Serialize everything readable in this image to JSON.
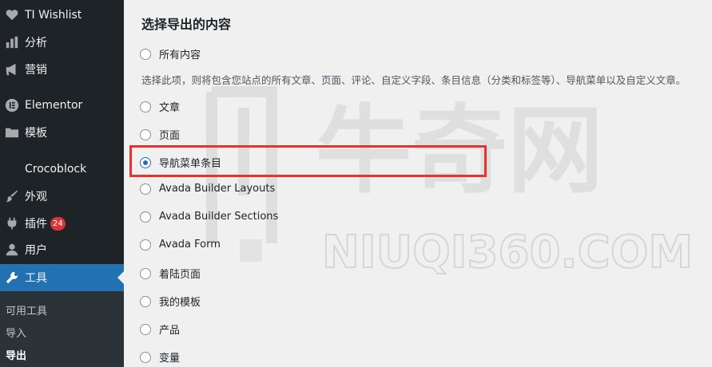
{
  "sidebar": {
    "items": [
      {
        "label": "TI Wishlist",
        "icon": "heart-icon"
      },
      {
        "label": "分析",
        "icon": "chart-icon"
      },
      {
        "label": "营销",
        "icon": "megaphone-icon"
      },
      {
        "label": "Elementor",
        "icon": "elementor-icon"
      },
      {
        "label": "模板",
        "icon": "folder-icon"
      },
      {
        "label": "Crocoblock",
        "icon": ""
      },
      {
        "label": "外观",
        "icon": "paintbrush-icon"
      },
      {
        "label": "插件",
        "icon": "plugin-icon",
        "badge": "24"
      },
      {
        "label": "用户",
        "icon": "user-icon"
      },
      {
        "label": "工具",
        "icon": "wrench-icon",
        "active": true
      }
    ],
    "submenu": [
      "可用工具",
      "导入",
      "导出"
    ],
    "current_sub": "导出"
  },
  "main": {
    "heading": "选择导出的内容",
    "options": [
      {
        "label": "所有内容",
        "checked": false
      },
      {
        "label": "文章",
        "checked": false
      },
      {
        "label": "页面",
        "checked": false
      },
      {
        "label": "导航菜单条目",
        "checked": true
      },
      {
        "label": "Avada Builder Layouts",
        "checked": false
      },
      {
        "label": "Avada Builder Sections",
        "checked": false
      },
      {
        "label": "Avada Form",
        "checked": false
      },
      {
        "label": "着陆页面",
        "checked": false
      },
      {
        "label": "我的模板",
        "checked": false
      },
      {
        "label": "产品",
        "checked": false
      },
      {
        "label": "变量",
        "checked": false
      }
    ],
    "description": "选择此项，则将包含您站点的所有文章、页面、评论、自定义字段、条目信息（分类和标签等）、导航菜单以及自定义文章。"
  },
  "watermark": {
    "brand": "牛奇网",
    "domain": "NIUQI360.COM"
  },
  "colors": {
    "sidebar_bg": "#1d2327",
    "active": "#2271b1",
    "highlight": "#e8322f",
    "badge": "#d63638"
  }
}
